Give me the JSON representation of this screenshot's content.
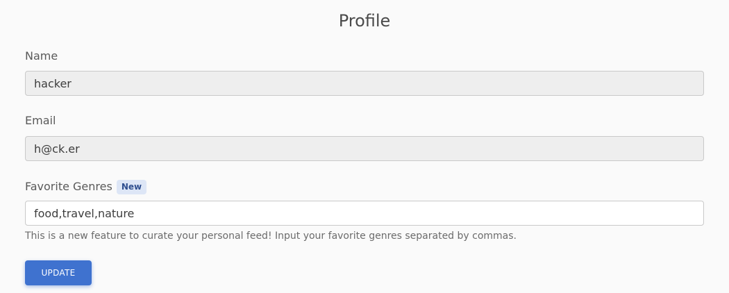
{
  "page": {
    "title": "Profile"
  },
  "form": {
    "name": {
      "label": "Name",
      "value": "hacker",
      "readonly": true
    },
    "email": {
      "label": "Email",
      "value": "h@ck.er",
      "readonly": true
    },
    "genres": {
      "label": "Favorite Genres",
      "badge": "New",
      "value": "food,travel,nature",
      "help": "This is a new feature to curate your personal feed! Input your favorite genres separated by commas."
    },
    "submit_label": "UPDATE"
  },
  "colors": {
    "primary": "#3f72cf",
    "badge_bg": "#dde6f6",
    "badge_text": "#2f4f8f",
    "readonly_bg": "#eeeeee",
    "page_bg": "#fafafa"
  }
}
